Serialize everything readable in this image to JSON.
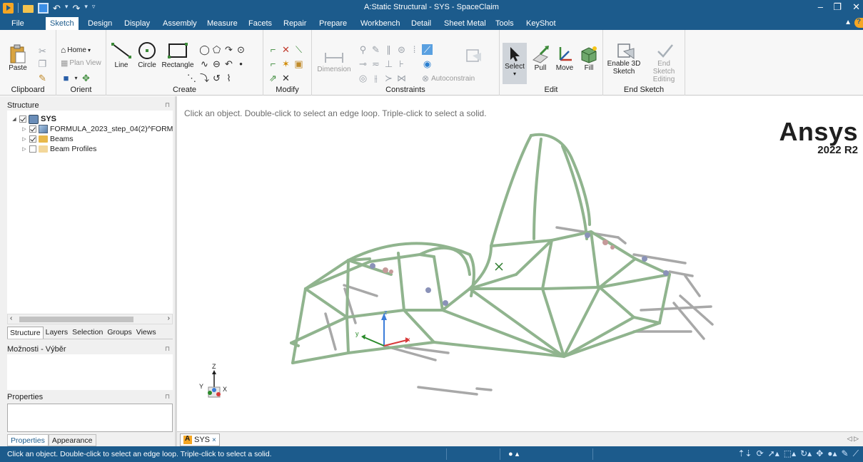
{
  "window": {
    "title": "A:Static Structural - SYS - SpaceClaim",
    "minimize": "–",
    "maximize": "❐",
    "close": "✕"
  },
  "quick_access": {
    "undo": "↶",
    "redo": "↷",
    "dropdown": "▾",
    "customize": "▿"
  },
  "tabs": [
    "File",
    "Sketch",
    "Design",
    "Display",
    "Assembly",
    "Measure",
    "Facets",
    "Repair",
    "Prepare",
    "Workbench",
    "Detail",
    "Sheet Metal",
    "Tools",
    "KeyShot"
  ],
  "active_tab": "Sketch",
  "ribbon": {
    "clipboard": {
      "label": "Clipboard",
      "paste": "Paste"
    },
    "orient": {
      "label": "Orient",
      "home": "Home",
      "plan_view": "Plan View"
    },
    "create": {
      "label": "Create",
      "line": "Line",
      "circle": "Circle",
      "rectangle": "Rectangle"
    },
    "modify": {
      "label": "Modify"
    },
    "constraints": {
      "label": "Constraints",
      "dimension": "Dimension",
      "autoconstrain": "Autoconstrain"
    },
    "edit": {
      "label": "Edit",
      "select": "Select",
      "pull": "Pull",
      "move": "Move",
      "fill": "Fill"
    },
    "end_sketch": {
      "label": "End Sketch",
      "enable_3d": "Enable 3D Sketch",
      "end_editing": "End Sketch Editing"
    }
  },
  "structure": {
    "header": "Structure",
    "tree": [
      {
        "label": "SYS",
        "level": 0
      },
      {
        "label": "FORMULA_2023_step_04(2)^FORM",
        "level": 1
      },
      {
        "label": "Beams",
        "level": 1
      },
      {
        "label": "Beam Profiles",
        "level": 1
      }
    ],
    "tabs": [
      "Structure",
      "Layers",
      "Selection",
      "Groups",
      "Views"
    ]
  },
  "options_panel": {
    "header": "Možnosti - Výběr"
  },
  "properties_panel": {
    "header": "Properties"
  },
  "bottom_tabs": [
    "Properties",
    "Appearance"
  ],
  "viewport": {
    "hint": "Click an object. Double-click to select an edge loop. Triple-click to select a solid.",
    "brand": "Ansys",
    "version": "2022 R2",
    "axis_z": "z",
    "axis_x": "x",
    "axis_y": "y",
    "triad_z": "Z",
    "triad_x": "X",
    "triad_y": "Y",
    "cursor": "✕"
  },
  "doc_tab": {
    "label": "SYS",
    "close": "×"
  },
  "status": {
    "text": "Click an object. Double-click to select an edge loop. Triple-click to select a solid.",
    "info_icon": "❶"
  },
  "colors": {
    "chrome_blue": "#1c5b8c",
    "frame_green": "#90b48e",
    "beam_gray": "#a8a8a8",
    "accent_orange": "#f5a623"
  }
}
